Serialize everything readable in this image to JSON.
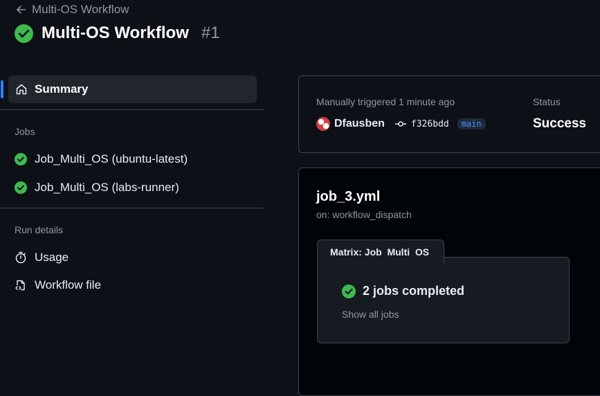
{
  "header": {
    "back_label": "Multi-OS Workflow",
    "title": "Multi-OS Workflow",
    "run_number": "#1"
  },
  "sidebar": {
    "summary_label": "Summary",
    "jobs_heading": "Jobs",
    "jobs": [
      {
        "label": "Job_Multi_OS (ubuntu-latest)",
        "status": "success"
      },
      {
        "label": "Job_Multi_OS (labs-runner)",
        "status": "success"
      }
    ],
    "run_details_heading": "Run details",
    "run_details": [
      {
        "label": "Usage",
        "icon": "stopwatch-icon"
      },
      {
        "label": "Workflow file",
        "icon": "file-code-icon"
      }
    ]
  },
  "summary_card": {
    "trigger_text": "Manually triggered 1 minute ago",
    "actor": "Dfausben",
    "commit_sha": "f326bdd",
    "branch": "main",
    "status_heading": "Status",
    "status_value": "Success"
  },
  "workflow_card": {
    "file_name": "job_3.yml",
    "trigger_event": "on: workflow_dispatch",
    "matrix_label": "Matrix: Job_Multi_OS",
    "jobs_completed": "2 jobs completed",
    "show_all_label": "Show all jobs"
  },
  "colors": {
    "background": "#0d1117",
    "success": "#3fb950",
    "accent": "#2f81f7",
    "muted": "#9198a1"
  }
}
